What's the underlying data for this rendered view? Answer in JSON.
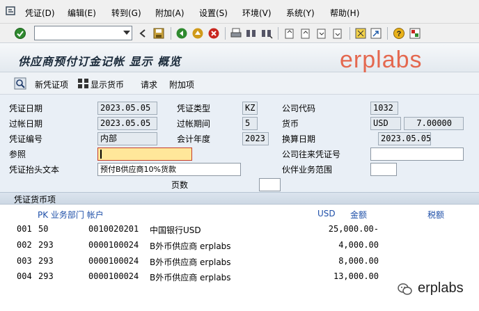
{
  "menu": {
    "items": [
      "凭证(D)",
      "编辑(E)",
      "转到(G)",
      "附加(A)",
      "设置(S)",
      "环境(V)",
      "系统(Y)",
      "帮助(H)"
    ]
  },
  "toolbar": {
    "command_value": "",
    "icons": [
      "enter-icon",
      "back-icon",
      "save-icon",
      "nav-back-icon",
      "exit-icon",
      "cancel-icon",
      "print-icon",
      "find-icon",
      "find-next-icon",
      "first-page-icon",
      "prev-page-icon",
      "next-page-icon",
      "last-page-icon",
      "create-session-icon",
      "shortcut-icon",
      "help-icon",
      "customize-icon"
    ]
  },
  "title": "供应商预付订金记帐 显示 概览",
  "watermark": "erplabs",
  "app_toolbar": {
    "new_doc": "新凭证项",
    "show_currency": "显示货币",
    "request": "请求",
    "extras": "附加项"
  },
  "form": {
    "doc_date_label": "凭证日期",
    "doc_date": "2023.05.05",
    "doc_type_label": "凭证类型",
    "doc_type": "KZ",
    "company_code_label": "公司代码",
    "company_code": "1032",
    "posting_date_label": "过帐日期",
    "posting_date": "2023.05.05",
    "period_label": "过帐期间",
    "period": "5",
    "currency_label": "货币",
    "currency": "USD",
    "exchange_rate": "7.00000",
    "doc_number_label": "凭证编号",
    "doc_number": "内部",
    "fiscal_year_label": "会计年度",
    "fiscal_year": "2023",
    "translation_date_label": "换算日期",
    "translation_date": "2023.05.05",
    "reference_label": "参照",
    "reference": "",
    "intercompany_label": "公司往来凭证号",
    "intercompany": "",
    "header_text_label": "凭证抬头文本",
    "header_text": "预付B供应商10%货款",
    "partner_ba_label": "伙伴业务范围",
    "partner_ba": "",
    "pages_label": "页数",
    "pages": ""
  },
  "items": {
    "section_title": "凭证货币项",
    "headers": {
      "pk_dept_acct": "PK 业务部门 帐户",
      "currency": "USD",
      "amount": "金额",
      "tax": "税额"
    },
    "rows": [
      {
        "item": "001",
        "pk": "50",
        "account": "0010020201",
        "name": "中国银行USD",
        "amount": "25,000.00-"
      },
      {
        "item": "002",
        "pk": "293",
        "account": "0000100024",
        "name": "B外币供应商 erplabs",
        "amount": "4,000.00"
      },
      {
        "item": "003",
        "pk": "293",
        "account": "0000100024",
        "name": "B外币供应商 erplabs",
        "amount": "8,000.00"
      },
      {
        "item": "004",
        "pk": "293",
        "account": "0000100024",
        "name": "B外币供应商 erplabs",
        "amount": "13,000.00"
      }
    ]
  },
  "footer_watermark": "erplabs"
}
